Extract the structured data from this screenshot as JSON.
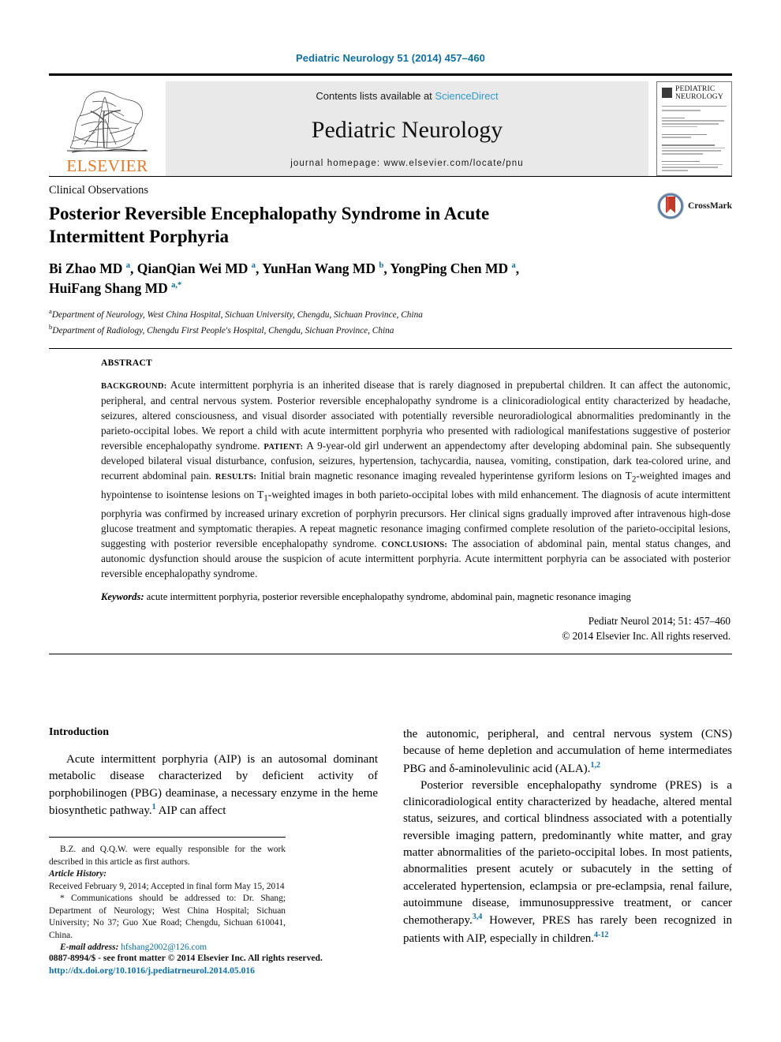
{
  "running_head": "Pediatric Neurology 51 (2014) 457–460",
  "masthead": {
    "publisher": "ELSEVIER",
    "contents_prefix": "Contents lists available at ",
    "sciencedirect": "ScienceDirect",
    "journal_name": "Pediatric Neurology",
    "homepage": "journal homepage: www.elsevier.com/locate/pnu",
    "cover_title": "PEDIATRIC NEUROLOGY"
  },
  "article": {
    "kicker": "Clinical Observations",
    "title": "Posterior Reversible Encephalopathy Syndrome in Acute Intermittent Porphyria",
    "crossmark_label": "CrossMark",
    "authors_line1": "Bi Zhao MD",
    "authors_html": "Bi Zhao MD <sup>a</sup>, QianQian Wei MD <sup>a</sup>, YunHan Wang MD <sup>b</sup>, YongPing Chen MD <sup>a</sup>, HuiFang Shang MD <sup>a,*</sup>",
    "affiliation_a": "Department of Neurology, West China Hospital, Sichuan University, Chengdu, Sichuan Province, China",
    "affiliation_b": "Department of Radiology, Chengdu First People's Hospital, Chengdu, Sichuan Province, China",
    "affiliation_a_marker": "a",
    "affiliation_b_marker": "b"
  },
  "abstract": {
    "heading": "ABSTRACT",
    "label_background": "BACKGROUND:",
    "text_background": " Acute intermittent porphyria is an inherited disease that is rarely diagnosed in prepubertal children. It can affect the autonomic, peripheral, and central nervous system. Posterior reversible encephalopathy syndrome is a clinicoradiological entity characterized by headache, seizures, altered consciousness, and visual disorder associated with potentially reversible neuroradiological abnormalities predominantly in the parieto-occipital lobes. We report a child with acute intermittent porphyria who presented with radiological manifestations suggestive of posterior reversible encephalopathy syndrome. ",
    "label_patient": "PATIENT:",
    "text_patient": " A 9-year-old girl underwent an appendectomy after developing abdominal pain. She subsequently developed bilateral visual disturbance, confusion, seizures, hypertension, tachycardia, nausea, vomiting, constipation, dark tea-colored urine, and recurrent abdominal pain. ",
    "label_results": "RESULTS:",
    "text_results_a": " Initial brain magnetic resonance imaging revealed hyperintense gyriform lesions on T",
    "text_results_sub1": "2",
    "text_results_b": "-weighted images and hypointense to isointense lesions on T",
    "text_results_sub2": "1",
    "text_results_c": "-weighted images in both parieto-occipital lobes with mild enhancement. The diagnosis of acute intermittent porphyria was confirmed by increased urinary excretion of porphyrin precursors. Her clinical signs gradually improved after intravenous high-dose glucose treatment and symptomatic therapies. A repeat magnetic resonance imaging confirmed complete resolution of the parieto-occipital lesions, suggesting with posterior reversible encephalopathy syndrome. ",
    "label_conclusions": "CONCLUSIONS:",
    "text_conclusions": " The association of abdominal pain, mental status changes, and autonomic dysfunction should arouse the suspicion of acute intermittent porphyria. Acute intermittent porphyria can be associated with posterior reversible encephalopathy syndrome.",
    "keywords_label": "Keywords:",
    "keywords_text": " acute intermittent porphyria, posterior reversible encephalopathy syndrome, abdominal pain, magnetic resonance imaging",
    "citation": "Pediatr Neurol 2014; 51: 457–460",
    "copyright": "© 2014 Elsevier Inc. All rights reserved."
  },
  "body": {
    "intro_heading": "Introduction",
    "left_para_1_a": "Acute intermittent porphyria (AIP) is an autosomal dominant metabolic disease characterized by deficient activity of porphobilinogen (PBG) deaminase, a necessary enzyme in the heme biosynthetic pathway.",
    "left_para_1_ref": "1",
    "left_para_1_b": " AIP can affect",
    "right_para_1_a": "the autonomic, peripheral, and central nervous system (CNS) because of heme depletion and accumulation of heme intermediates PBG and δ-aminolevulinic acid (ALA).",
    "right_para_1_ref": "1,2",
    "right_para_2_a": "Posterior reversible encephalopathy syndrome (PRES) is a clinicoradiological entity characterized by headache, altered mental status, seizures, and cortical blindness associated with a potentially reversible imaging pattern, predominantly white matter, and gray matter abnormalities of the parieto-occipital lobes. In most patients, abnormalities present acutely or subacutely in the setting of accelerated hypertension, eclampsia or pre-eclampsia, renal failure, autoimmune disease, immunosuppressive treatment, or cancer chemotherapy.",
    "right_para_2_ref1": "3,4",
    "right_para_2_b": " However, PRES has rarely been recognized in patients with AIP, especially in children.",
    "right_para_2_ref2": "4-12"
  },
  "footnotes": {
    "equal_contrib": "B.Z. and Q.Q.W. were equally responsible for the work described in this article as first authors.",
    "article_history_label": "Article History:",
    "article_history": "Received February 9, 2014; Accepted in final form May 15, 2014",
    "correspondence": "* Communications should be addressed to: Dr. Shang; Department of Neurology; West China Hospital; Sichuan University; No 37; Guo Xue Road; Chengdu, Sichuan 610041, China.",
    "email_label": "E-mail address:",
    "email": "hfshang2002@126.com"
  },
  "page_footer": {
    "issn_line": "0887-8994/$ - see front matter © 2014 Elsevier Inc. All rights reserved.",
    "doi": "http://dx.doi.org/10.1016/j.pediatrneurol.2014.05.016"
  },
  "colors": {
    "link_blue": "#0a6ea8",
    "sciencedirect_blue": "#2e9ad0",
    "elsevier_orange": "#e87722",
    "band_gray": "#e9e9e9"
  }
}
